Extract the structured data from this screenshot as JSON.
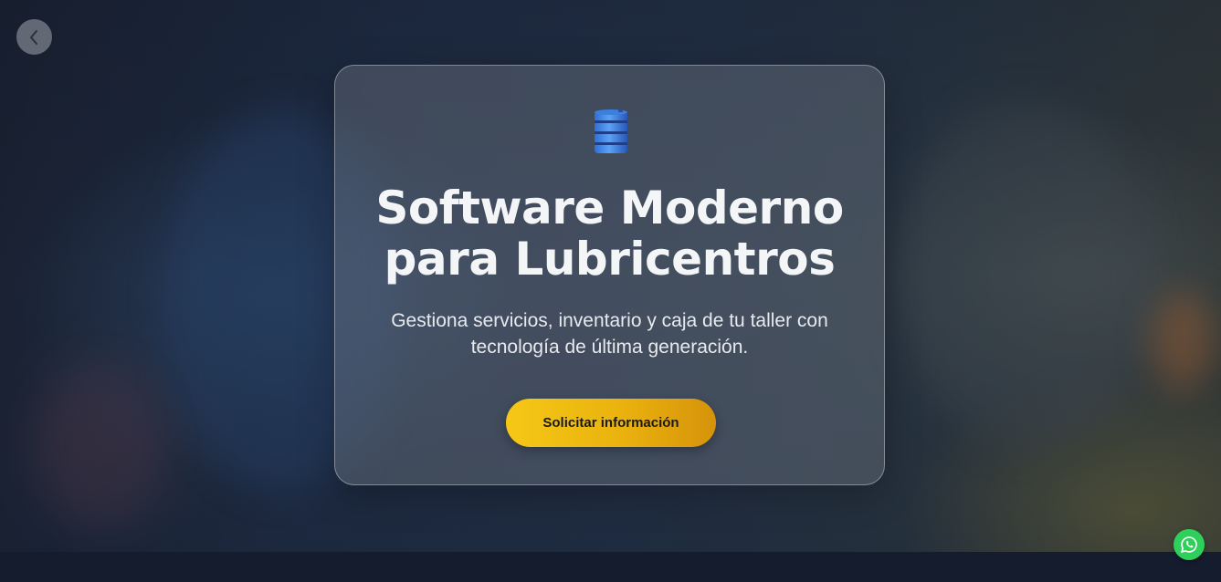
{
  "hero": {
    "icon": "oil-barrel-icon",
    "title": "Software Moderno para Lubricentros",
    "subtitle": "Gestiona servicios, inventario y caja de tu taller con tecnología de última generación.",
    "cta_label": "Solicitar información"
  },
  "nav": {
    "back_icon": "chevron-left-icon"
  },
  "floating": {
    "whatsapp_icon": "whatsapp-icon"
  },
  "colors": {
    "accent": "#f5c816",
    "whatsapp": "#2ecf5a",
    "background": "#121a2b"
  }
}
